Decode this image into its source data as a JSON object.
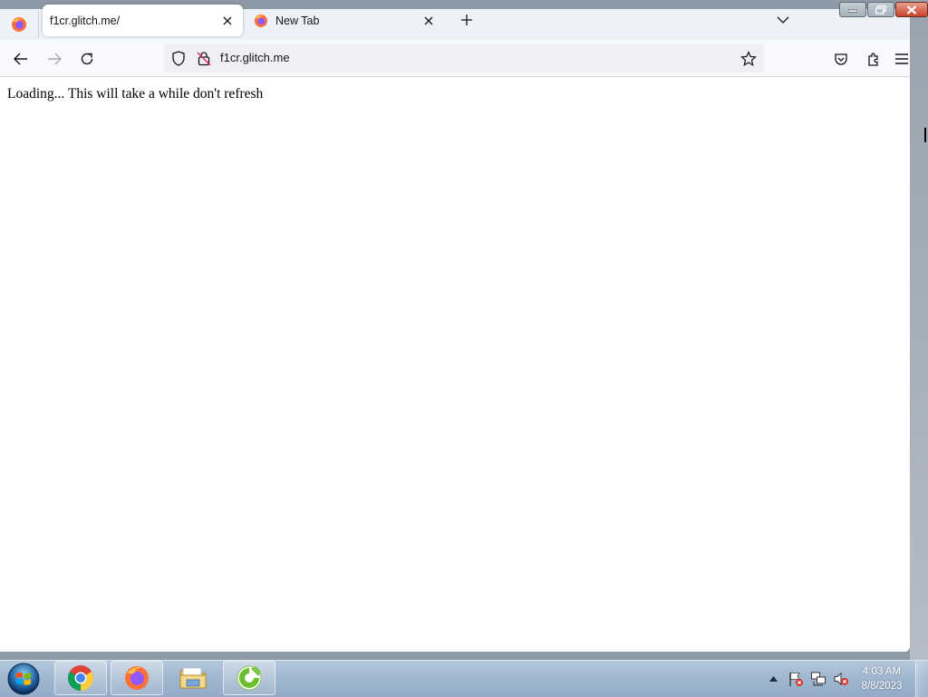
{
  "browser": {
    "tabs": [
      {
        "title": "f1cr.glitch.me/",
        "active": true
      },
      {
        "title": "New Tab",
        "active": false
      }
    ],
    "url": "f1cr.glitch.me"
  },
  "page": {
    "message": "Loading... This will take a while don't refresh"
  },
  "taskbar": {
    "apps": [
      "chrome-icon",
      "firefox-icon",
      "file-explorer-icon",
      "greenshot-icon"
    ],
    "clock_time": "4:03 AM",
    "clock_date": "8/8/2023"
  },
  "colors": {
    "firefox_orange": "#ff7139",
    "firefox_purple": "#9059ff",
    "window_close_red": "#c8412a"
  }
}
